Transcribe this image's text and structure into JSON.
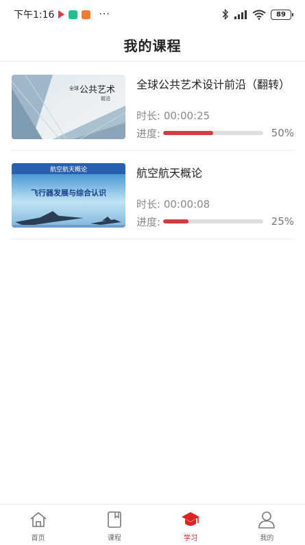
{
  "status_bar": {
    "time": "下午1:16",
    "more": "···",
    "battery": "89"
  },
  "header": {
    "title": "我的课程"
  },
  "courses": [
    {
      "title": "全球公共艺术设计前沿（翻转）",
      "duration_label": "时长:",
      "duration": "00:00:25",
      "progress_label": "进度:",
      "progress": 0.5,
      "progress_text": "50%",
      "thumb_text_main": "公共艺术",
      "thumb_text_sub": "全球",
      "thumb_text_tail": "前沿"
    },
    {
      "title": "航空航天概论",
      "duration_label": "时长:",
      "duration": "00:00:08",
      "progress_label": "进度:",
      "progress": 0.25,
      "progress_text": "25%",
      "thumb_text_main": "飞行器发展与综合认识",
      "thumb_text_sub": "航空航天概论"
    }
  ],
  "tabbar": {
    "items": [
      {
        "label": "首页",
        "icon": "home-icon",
        "active": false
      },
      {
        "label": "课程",
        "icon": "book-icon",
        "active": false
      },
      {
        "label": "学习",
        "icon": "graduation-cap-icon",
        "active": true
      },
      {
        "label": "我的",
        "icon": "user-icon",
        "active": false
      }
    ]
  },
  "colors": {
    "accent": "#d9393e",
    "track": "#dddddd"
  }
}
